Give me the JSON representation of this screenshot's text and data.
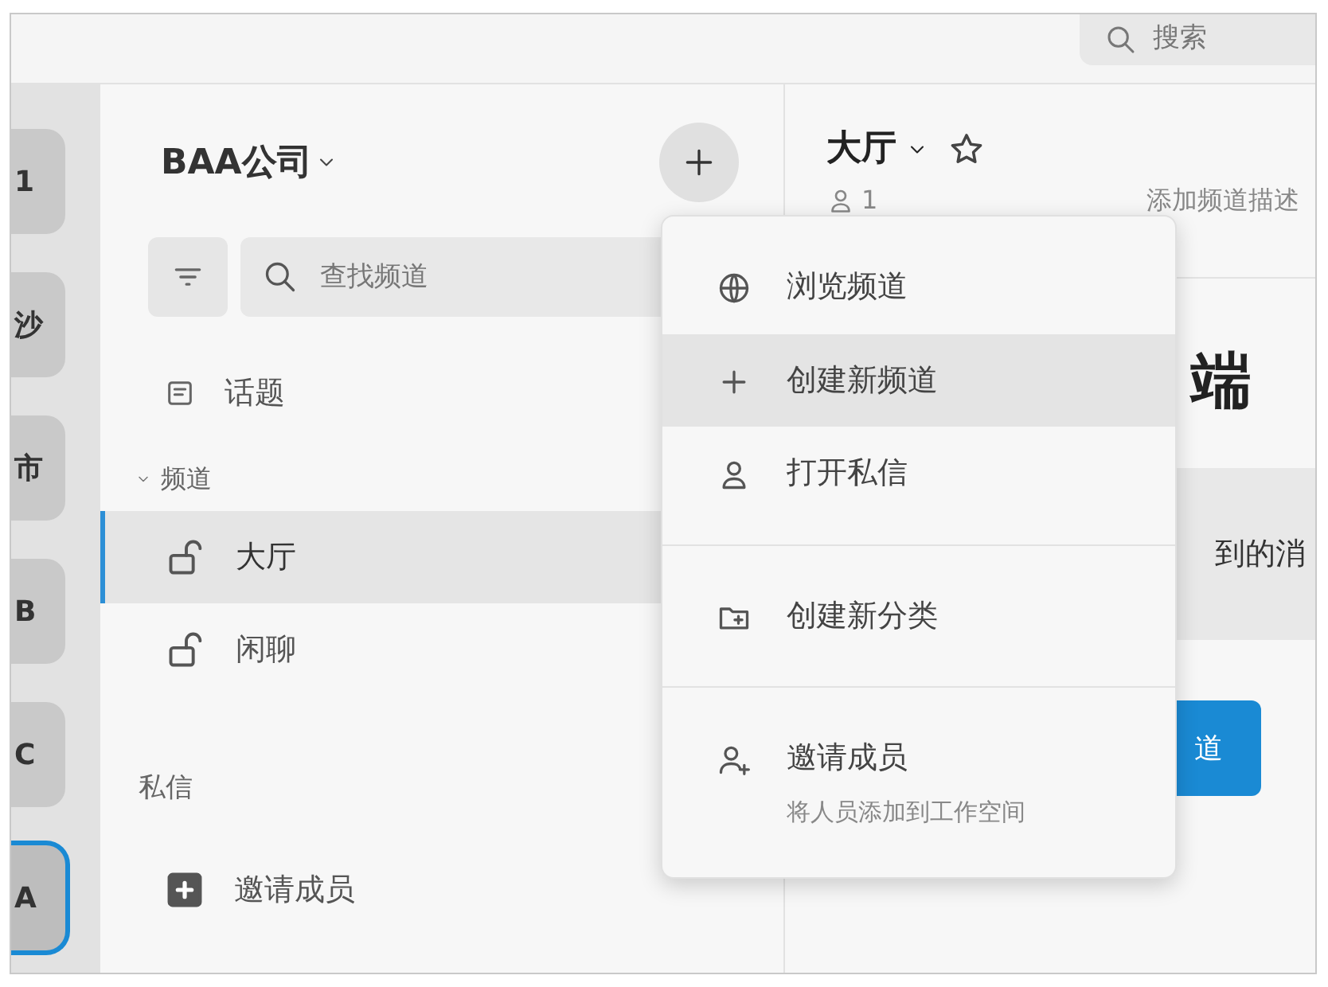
{
  "top_bar": {
    "search": {
      "placeholder": "搜索"
    }
  },
  "workspaces": [
    {
      "label": "1",
      "selected": false
    },
    {
      "label": "沙",
      "selected": false
    },
    {
      "label": "市",
      "selected": false
    },
    {
      "label": "B",
      "selected": false
    },
    {
      "label": "C",
      "selected": false
    },
    {
      "label": "A",
      "selected": true
    }
  ],
  "sidebar": {
    "workspace_name": "BAA公司",
    "search": {
      "placeholder": "查找频道"
    },
    "threads": "话题",
    "channels_header": "频道",
    "channels_expanded": true,
    "channels": [
      {
        "name": "大厅",
        "selected": true
      },
      {
        "name": "闲聊",
        "selected": false
      }
    ],
    "dm_header": "私信",
    "invite": "邀请成员"
  },
  "channel": {
    "title": "大厅",
    "starred": false,
    "member_count": "1",
    "description_placeholder": "添加频道描述",
    "heading": "端",
    "banner": "到的消",
    "button": "道"
  },
  "menu": {
    "items": [
      {
        "kind": "browse",
        "label": "浏览频道",
        "hovered": false,
        "divider_before": false
      },
      {
        "kind": "create",
        "label": "创建新频道",
        "hovered": true,
        "divider_before": false
      },
      {
        "kind": "dm",
        "label": "打开私信",
        "hovered": false,
        "divider_before": false
      },
      {
        "kind": "category",
        "label": "创建新分类",
        "hovered": false,
        "divider_before": true
      },
      {
        "kind": "invite",
        "label": "邀请成员",
        "subtitle": "将人员添加到工作空间",
        "hovered": false,
        "divider_before": true
      }
    ]
  }
}
